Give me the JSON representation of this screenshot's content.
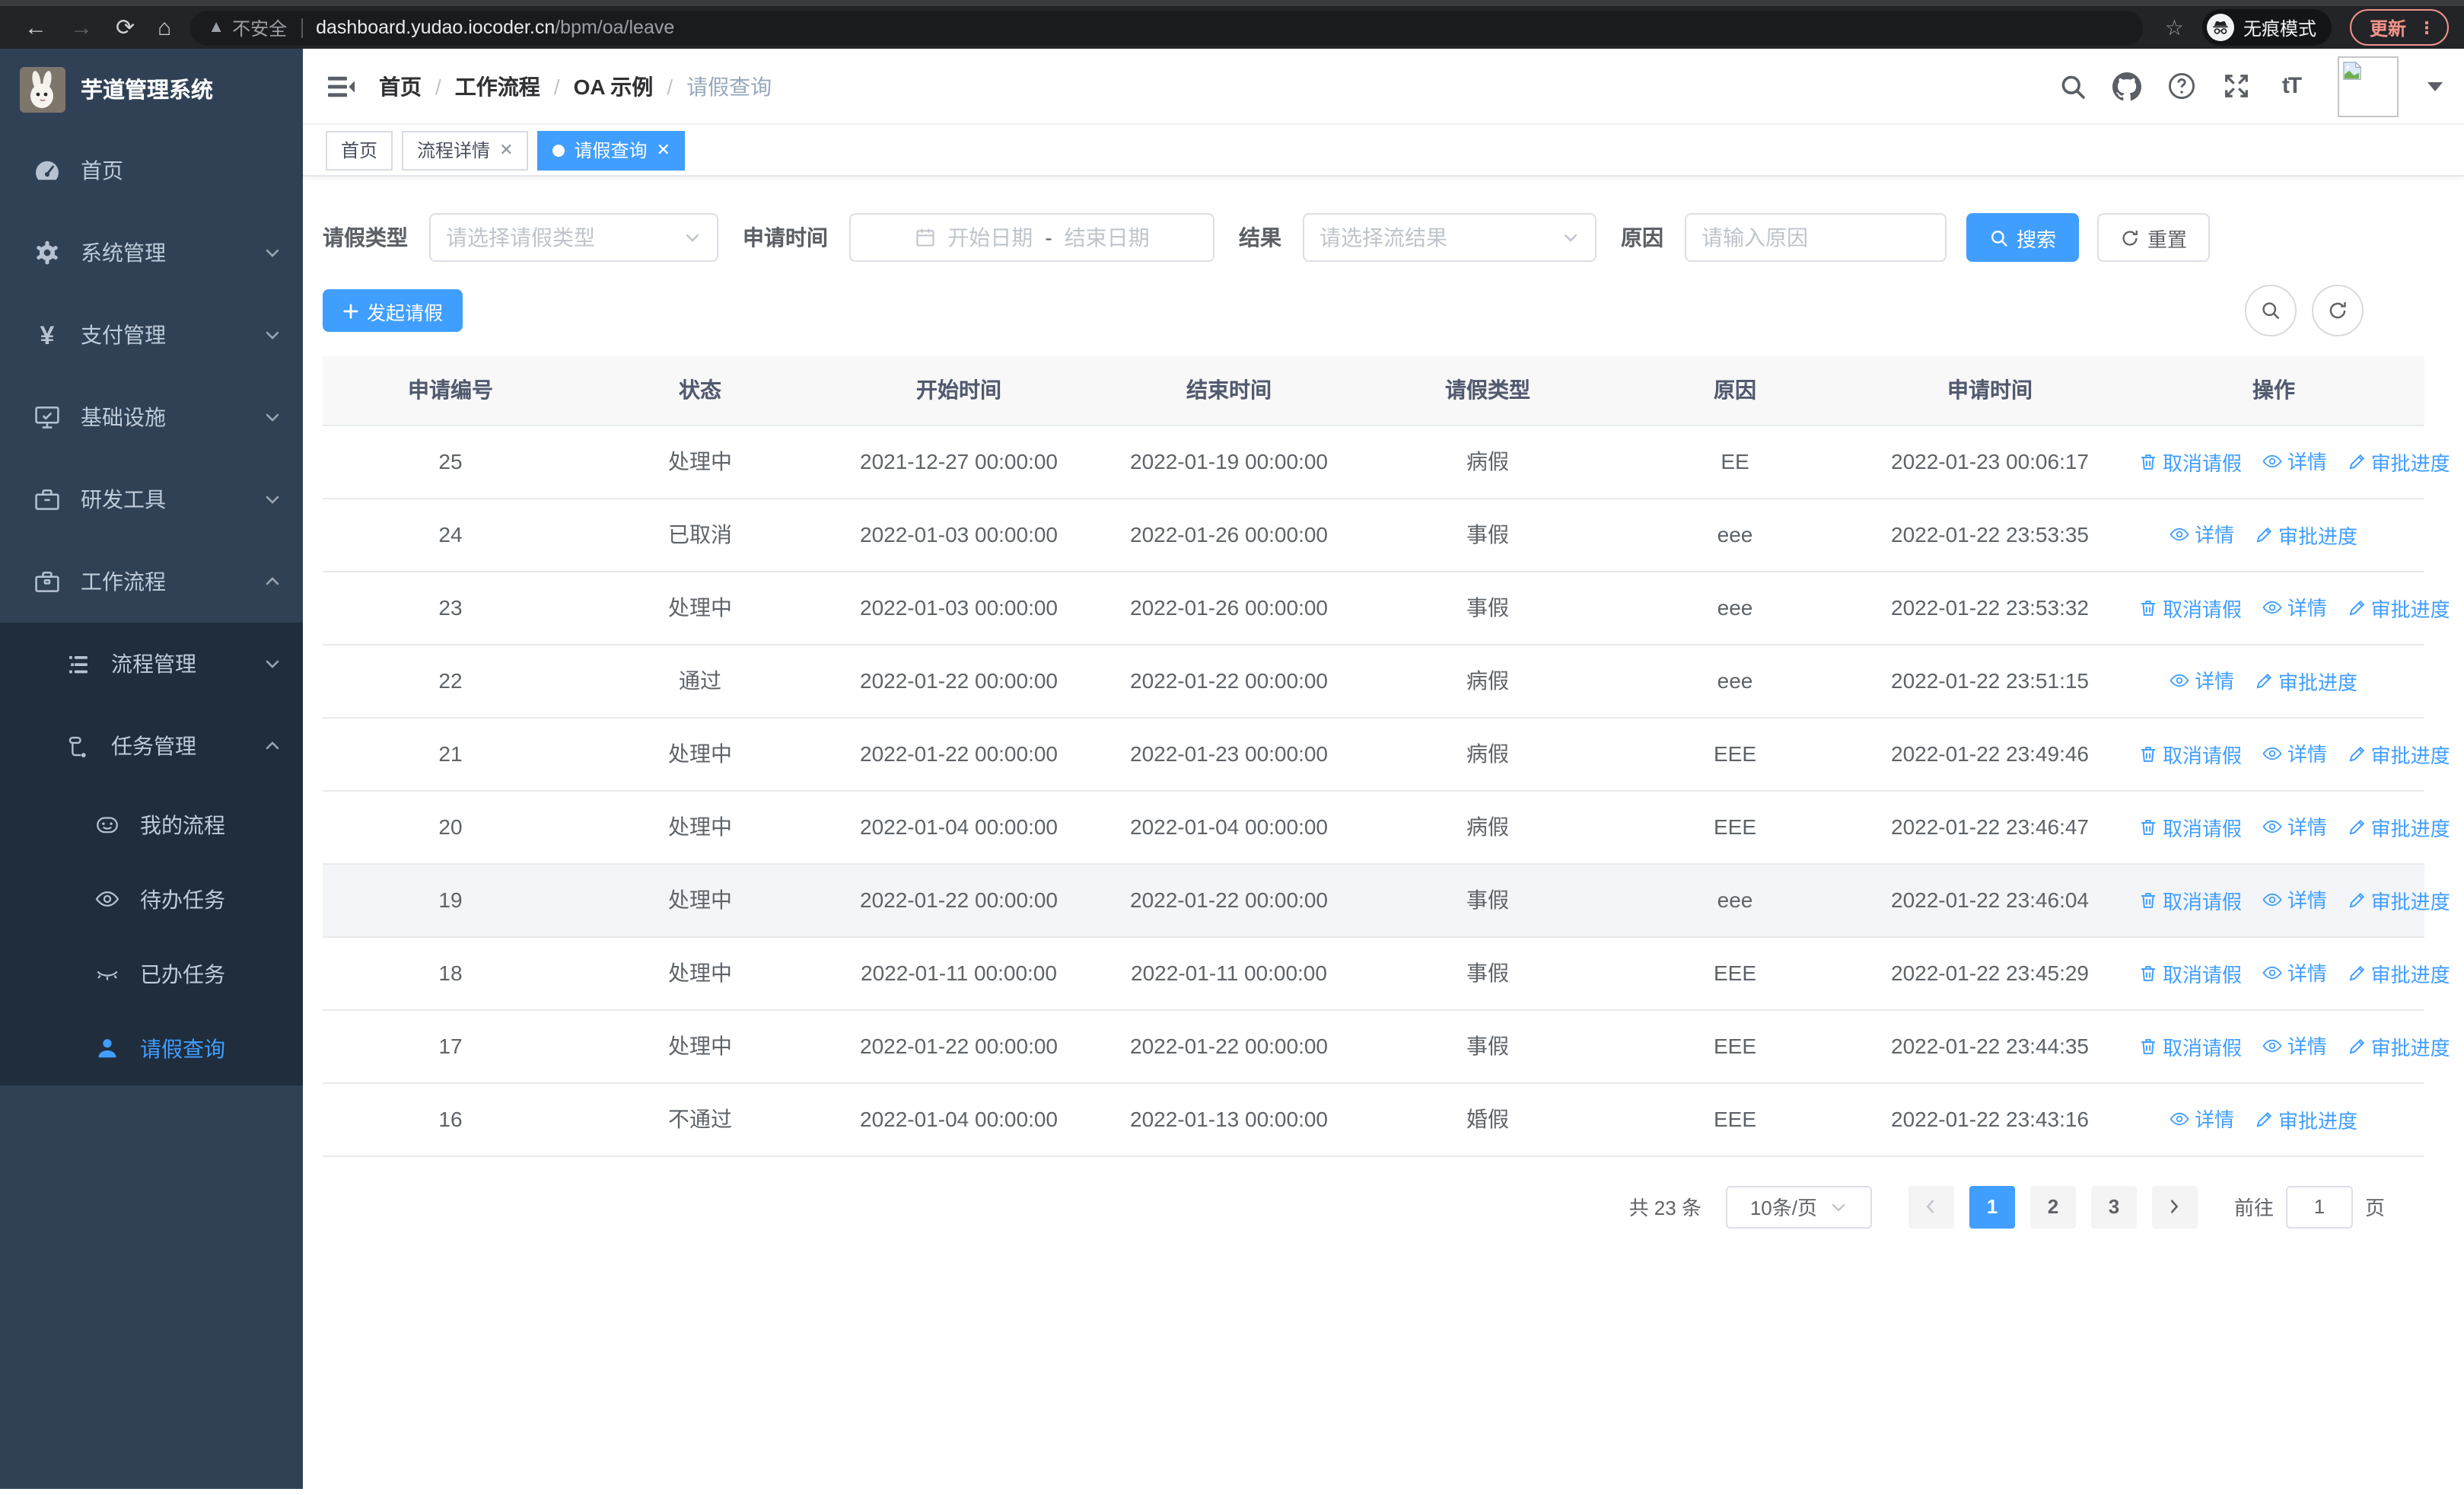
{
  "colors": {
    "accent": "#409eff",
    "sidebar_bg": "#304156",
    "submenu_bg": "#1f2d3d",
    "sidebar_text": "#bfcbd9",
    "update_pill": "#ef9289"
  },
  "chrome": {
    "not_secure": "不安全",
    "url_host": "dashboard.yudao.iocoder.cn",
    "url_path": "/bpm/oa/leave",
    "incognito_label": "无痕模式",
    "update_label": "更新"
  },
  "sidebar": {
    "title": "芋道管理系统",
    "menu": {
      "home": "首页",
      "system": "系统管理",
      "pay": "支付管理",
      "infra": "基础设施",
      "dev": "研发工具",
      "workflow": "工作流程",
      "process_mgmt": "流程管理",
      "task_mgmt": "任务管理",
      "my_process": "我的流程",
      "todo_task": "待办任务",
      "done_task": "已办任务",
      "leave_query": "请假查询"
    }
  },
  "header": {
    "breadcrumb": [
      "首页",
      "工作流程",
      "OA 示例",
      "请假查询"
    ]
  },
  "tabs": [
    {
      "label": "首页"
    },
    {
      "label": "流程详情"
    },
    {
      "label": "请假查询"
    }
  ],
  "filters": {
    "leave_type_label": "请假类型",
    "leave_type_placeholder": "请选择请假类型",
    "apply_time_label": "申请时间",
    "date_start_placeholder": "开始日期",
    "date_separator": "-",
    "date_end_placeholder": "结束日期",
    "result_label": "结果",
    "result_placeholder": "请选择流结果",
    "reason_label": "原因",
    "reason_placeholder": "请输入原因",
    "search_label": "搜索",
    "reset_label": "重置"
  },
  "toolbar": {
    "create_label": "发起请假"
  },
  "table": {
    "columns": [
      "申请编号",
      "状态",
      "开始时间",
      "结束时间",
      "请假类型",
      "原因",
      "申请时间",
      "操作"
    ],
    "actions": {
      "cancel": "取消请假",
      "detail": "详情",
      "progress": "审批进度"
    },
    "rows": [
      {
        "id": "25",
        "status": "处理中",
        "start": "2021-12-27 00:00:00",
        "end": "2022-01-19 00:00:00",
        "type": "病假",
        "reason": "EE",
        "applyTime": "2022-01-23 00:06:17",
        "cancelable": true,
        "hovered": false
      },
      {
        "id": "24",
        "status": "已取消",
        "start": "2022-01-03 00:00:00",
        "end": "2022-01-26 00:00:00",
        "type": "事假",
        "reason": "eee",
        "applyTime": "2022-01-22 23:53:35",
        "cancelable": false,
        "hovered": false
      },
      {
        "id": "23",
        "status": "处理中",
        "start": "2022-01-03 00:00:00",
        "end": "2022-01-26 00:00:00",
        "type": "事假",
        "reason": "eee",
        "applyTime": "2022-01-22 23:53:32",
        "cancelable": true,
        "hovered": false
      },
      {
        "id": "22",
        "status": "通过",
        "start": "2022-01-22 00:00:00",
        "end": "2022-01-22 00:00:00",
        "type": "病假",
        "reason": "eee",
        "applyTime": "2022-01-22 23:51:15",
        "cancelable": false,
        "hovered": false
      },
      {
        "id": "21",
        "status": "处理中",
        "start": "2022-01-22 00:00:00",
        "end": "2022-01-23 00:00:00",
        "type": "病假",
        "reason": "EEE",
        "applyTime": "2022-01-22 23:49:46",
        "cancelable": true,
        "hovered": false
      },
      {
        "id": "20",
        "status": "处理中",
        "start": "2022-01-04 00:00:00",
        "end": "2022-01-04 00:00:00",
        "type": "病假",
        "reason": "EEE",
        "applyTime": "2022-01-22 23:46:47",
        "cancelable": true,
        "hovered": false
      },
      {
        "id": "19",
        "status": "处理中",
        "start": "2022-01-22 00:00:00",
        "end": "2022-01-22 00:00:00",
        "type": "事假",
        "reason": "eee",
        "applyTime": "2022-01-22 23:46:04",
        "cancelable": true,
        "hovered": true
      },
      {
        "id": "18",
        "status": "处理中",
        "start": "2022-01-11 00:00:00",
        "end": "2022-01-11 00:00:00",
        "type": "事假",
        "reason": "EEE",
        "applyTime": "2022-01-22 23:45:29",
        "cancelable": true,
        "hovered": false
      },
      {
        "id": "17",
        "status": "处理中",
        "start": "2022-01-22 00:00:00",
        "end": "2022-01-22 00:00:00",
        "type": "事假",
        "reason": "EEE",
        "applyTime": "2022-01-22 23:44:35",
        "cancelable": true,
        "hovered": false
      },
      {
        "id": "16",
        "status": "不通过",
        "start": "2022-01-04 00:00:00",
        "end": "2022-01-13 00:00:00",
        "type": "婚假",
        "reason": "EEE",
        "applyTime": "2022-01-22 23:43:16",
        "cancelable": false,
        "hovered": false
      }
    ]
  },
  "pagination": {
    "total_text": "共 23 条",
    "page_size": "10条/页",
    "pages": [
      "1",
      "2",
      "3"
    ],
    "active_page": "1",
    "jump_prefix": "前往",
    "jump_value": "1",
    "jump_suffix": "页"
  }
}
